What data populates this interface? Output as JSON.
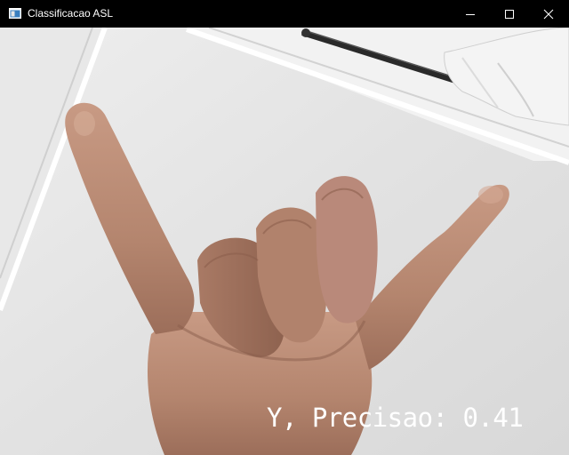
{
  "window": {
    "title": "Classificacao ASL",
    "controls": {
      "minimize_icon": "minimize-icon",
      "maximize_icon": "maximize-icon",
      "close_icon": "close-icon"
    }
  },
  "prediction": {
    "overlay_text": "Y, Precisao: 0.41"
  },
  "colors": {
    "titlebar_bg": "#000000",
    "title_text": "#ffffff",
    "overlay_text": "#ffffff",
    "ceiling": "#e4e4e4",
    "skin": "#b98a72"
  }
}
